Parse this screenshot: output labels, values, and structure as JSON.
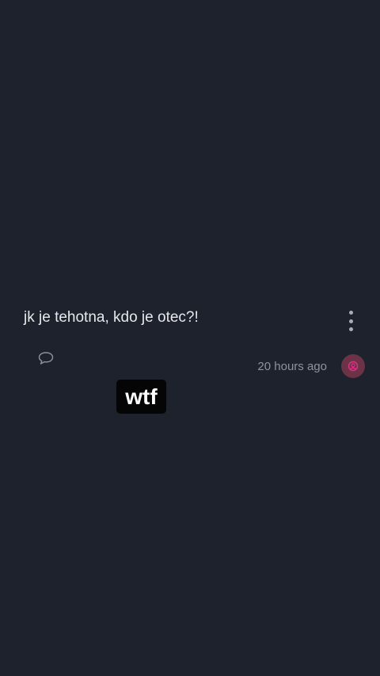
{
  "post": {
    "text": "jk je tehotna, kdo je otec?!",
    "timestamp": "20 hours ago",
    "sticker_text": "wtf"
  },
  "icons": {
    "more": "more-vertical-icon",
    "comment": "comment-bubble-icon",
    "avatar": "avatar-icon"
  },
  "colors": {
    "background": "#1e222c",
    "avatar_bg": "#6c3347",
    "avatar_accent": "#e0318a"
  }
}
